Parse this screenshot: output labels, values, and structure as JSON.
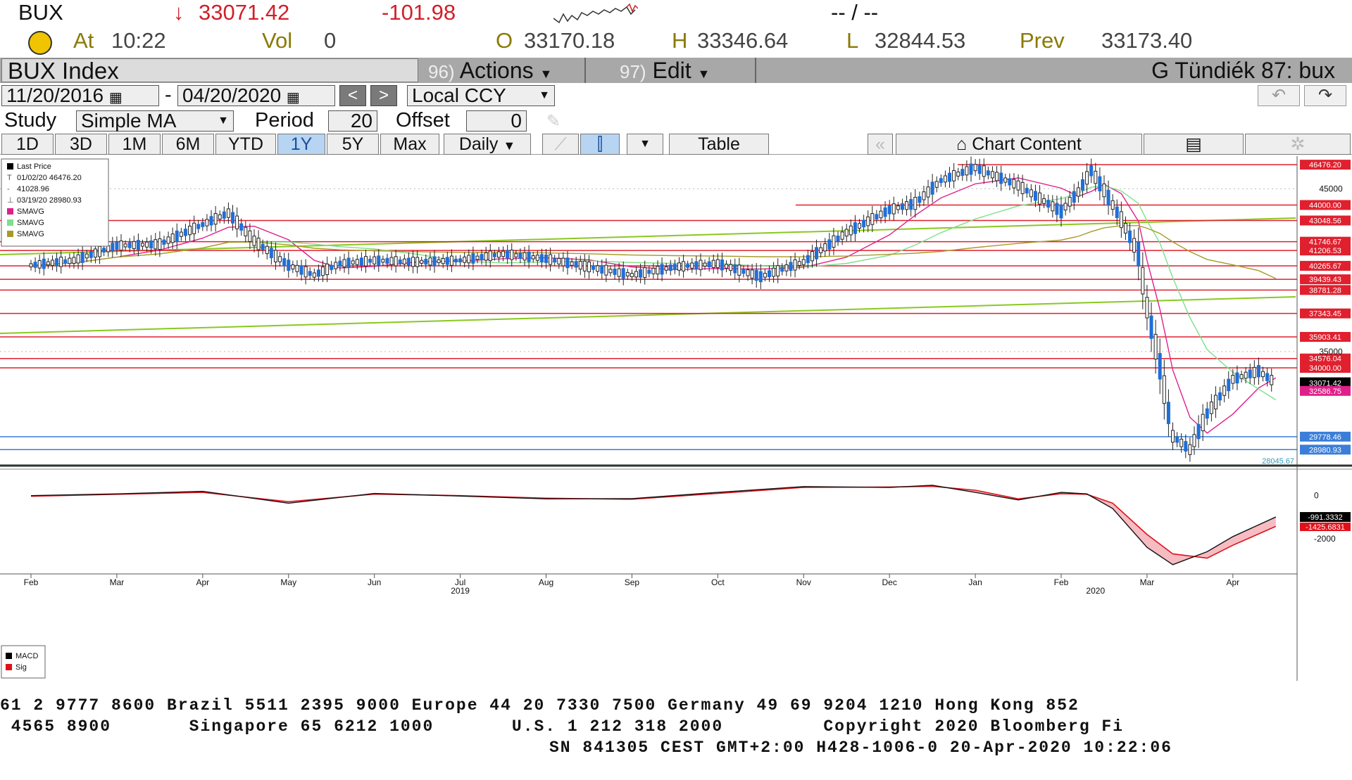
{
  "quote": {
    "ticker": "BUX",
    "last_price": "33071.42",
    "direction_arrow": "↓",
    "change": "-101.98",
    "time_label": "At",
    "time": "10:22",
    "vol_label": "Vol",
    "volume": "0",
    "open_label": "O",
    "open": "33170.18",
    "high_label": "H",
    "high": "33346.64",
    "low_label": "L",
    "low": "32844.53",
    "prev_label": "Prev",
    "prev": "33173.40",
    "bid_ask": "-- / --"
  },
  "toolbar": {
    "security_name": "BUX Index",
    "actions_num": "96)",
    "actions_label": "Actions",
    "edit_num": "97)",
    "edit_label": "Edit",
    "user_label": "G Tündiék 87: bux",
    "start_date": "11/20/2016",
    "date_separator": "-",
    "end_date": "04/20/2020",
    "prev_button": "<",
    "next_button": ">",
    "currency": "Local CCY",
    "study_label": "Study",
    "study_value": "Simple MA",
    "period_label": "Period",
    "period_value": "20",
    "offset_label": "Offset",
    "offset_value": "0",
    "ranges": [
      "1D",
      "3D",
      "1M",
      "6M",
      "YTD",
      "1Y",
      "5Y",
      "Max"
    ],
    "active_range": "1Y",
    "frequency": "Daily",
    "table_label": "Table",
    "chart_content_label": "Chart Content"
  },
  "legend": {
    "items": [
      "Last Price",
      "01/02/20 46476.20",
      "41028.96",
      "03/19/20 28980.93",
      "SMAVG",
      "SMAVG",
      "SMAVG"
    ],
    "colors": [
      "#000000",
      "#666666",
      "#666666",
      "#666666",
      "#e0208a",
      "#7ee08a",
      "#a89a2a"
    ]
  },
  "macd_legend": {
    "items": [
      "MACD",
      "Sig"
    ],
    "colors": [
      "#000000",
      "#e0101a"
    ]
  },
  "chart_data": {
    "type": "line",
    "title": "BUX Index",
    "ylim": [
      28000,
      47000
    ],
    "x_ticks": [
      "Feb",
      "Mar",
      "Apr",
      "May",
      "Jun",
      "Jul",
      "Aug",
      "Sep",
      "Oct",
      "Nov",
      "Dec",
      "Jan",
      "Feb",
      "Mar",
      "Apr"
    ],
    "year_labels": [
      {
        "label": "2019",
        "month": "Jul"
      },
      {
        "label": "2020",
        "month": "Feb"
      }
    ],
    "y_ticks": [
      "45000",
      "35000"
    ],
    "price_series": {
      "name": "Last Price",
      "months": [
        "Feb",
        "Mar",
        "Apr",
        "May",
        "Jun",
        "Jul",
        "Aug",
        "Sep",
        "Oct",
        "Nov",
        "Dec",
        "Jan",
        "Feb",
        "Mar",
        "Apr"
      ],
      "x": [
        0,
        0.5,
        1,
        1.5,
        2,
        2.3,
        2.6,
        3,
        3.3,
        3.6,
        4,
        4.5,
        5,
        5.5,
        6,
        6.5,
        7,
        7.5,
        8,
        8.5,
        9,
        9.5,
        10,
        10.3,
        10.6,
        11,
        11.5,
        12,
        12.2,
        12.35,
        12.5,
        12.7,
        12.9,
        13,
        13.15,
        13.3,
        13.5,
        13.7,
        14,
        14.3,
        14.5
      ],
      "values": [
        40300,
        40600,
        41500,
        41600,
        42800,
        43500,
        41800,
        40300,
        39700,
        40400,
        40600,
        40500,
        40600,
        41000,
        40700,
        40200,
        39700,
        40200,
        40400,
        39600,
        40500,
        42300,
        43700,
        44100,
        45500,
        46300,
        45200,
        43600,
        44800,
        46100,
        44900,
        43100,
        41000,
        37700,
        34100,
        29800,
        28981,
        31200,
        33300,
        33800,
        33071
      ],
      "min_point": {
        "date": "03/19/20",
        "value": 28980.93
      },
      "max_point": {
        "date": "01/02/20",
        "value": 46476.2
      },
      "last_value": 33071.42
    },
    "sma_series": [
      {
        "name": "SMAVG",
        "color": "#e0208a"
      },
      {
        "name": "SMAVG",
        "color": "#7ee08a"
      },
      {
        "name": "SMAVG",
        "color": "#a89a2a"
      }
    ],
    "sma20_last": 32586.75,
    "horizontal_levels": [
      46476.2,
      44000.0,
      43048.56,
      41746.67,
      41206.53,
      40265.67,
      39439.43,
      38781.28,
      37343.45,
      35903.41,
      34576.04,
      34000.0,
      29778.46,
      28980.93
    ],
    "level_labels": [
      "46476.20",
      "44000.00",
      "43048.56",
      "41746.67",
      "41206.53",
      "40265.67",
      "39439.43",
      "38781.28",
      "37343.45",
      "35903.41",
      "34576.04",
      "34000.00",
      "29778.46",
      "28980.93"
    ],
    "last_label": "33071.42",
    "sma_label": "32586.75",
    "low_note": "28045.67",
    "macd": {
      "ylim": [
        -3500,
        1000
      ],
      "y_ticks": [
        "0",
        "-2000"
      ],
      "macd_last": "-991.3332",
      "sig_last": "-1425.6831",
      "x": [
        0,
        1,
        2,
        3,
        4,
        5,
        6,
        7,
        8,
        9,
        10,
        10.5,
        11,
        11.5,
        12,
        12.3,
        12.6,
        13,
        13.3,
        13.7,
        14,
        14.5
      ],
      "macd_values": [
        0,
        80,
        200,
        -350,
        100,
        -20,
        -150,
        -140,
        150,
        420,
        380,
        480,
        150,
        -200,
        150,
        80,
        -600,
        -2400,
        -3200,
        -2600,
        -1900,
        -991
      ],
      "sig_values": [
        -30,
        60,
        150,
        -280,
        70,
        0,
        -120,
        -170,
        100,
        380,
        400,
        430,
        250,
        -150,
        90,
        60,
        -350,
        -1800,
        -2700,
        -2900,
        -2300,
        -1426
      ]
    }
  },
  "footer": {
    "line1": "61 2 9777 8600 Brazil 5511 2395 9000 Europe 44 20 7330 7500 Germany 49 69 9204 1210 Hong Kong 852",
    "line2": " 4565 8900       Singapore 65 6212 1000       U.S. 1 212 318 2000         Copyright 2020 Bloomberg Fi",
    "line3": "SN 841305 CEST GMT+2:00 H428-1006-0 20-Apr-2020 10:22:06"
  }
}
